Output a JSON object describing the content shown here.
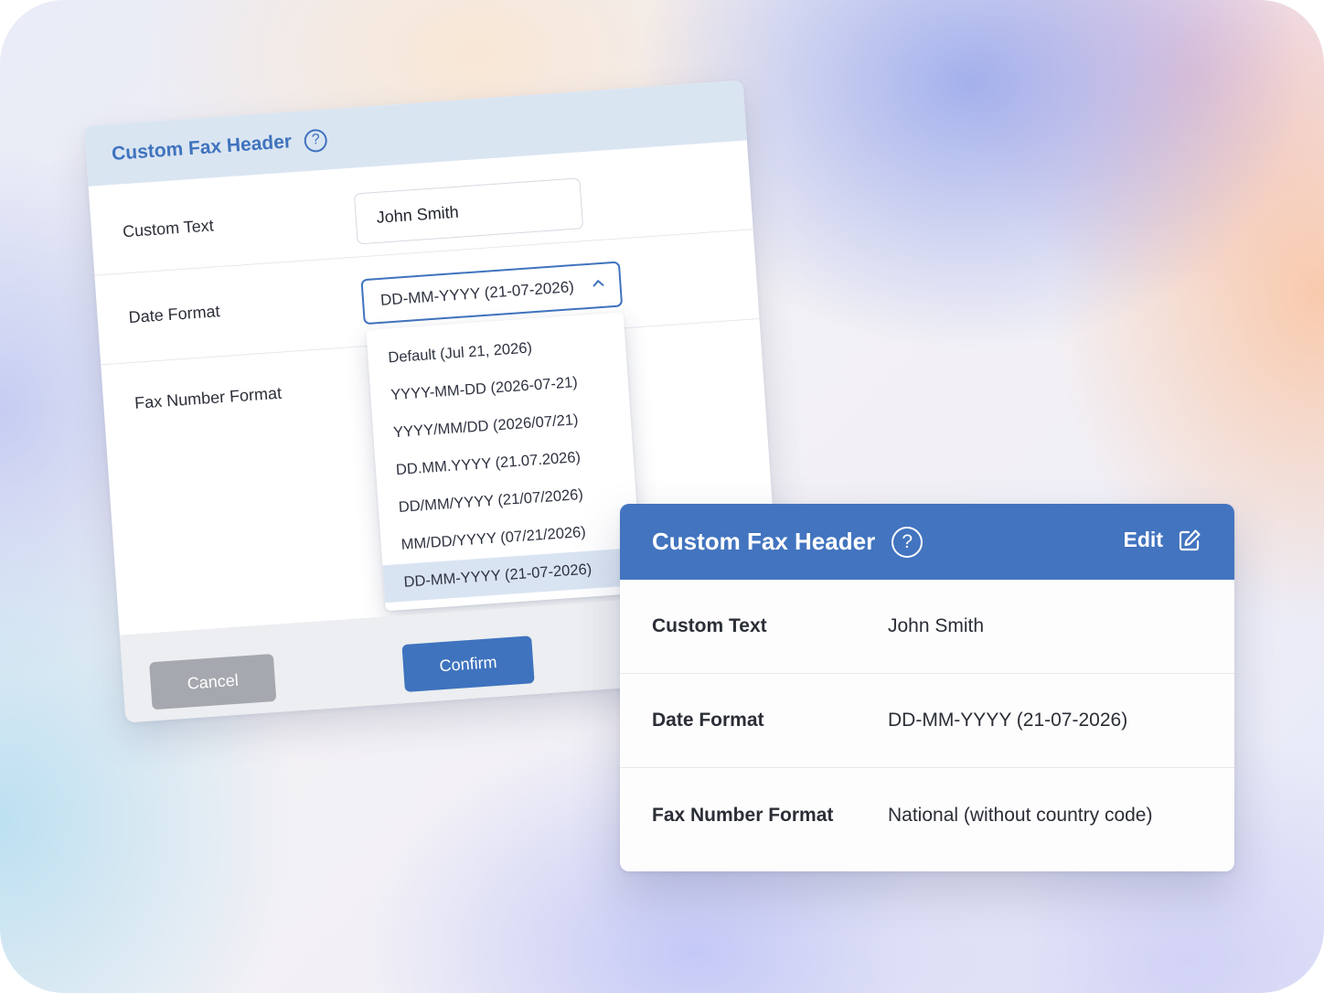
{
  "edit_dialog": {
    "title": "Custom Fax Header",
    "help_icon_glyph": "?",
    "fields": {
      "custom_text_label": "Custom Text",
      "custom_text_value": "John Smith",
      "date_format_label": "Date Format",
      "date_format_selected": "DD-MM-YYYY (21-07-2026)",
      "fax_number_format_label": "Fax Number Format"
    },
    "date_format_options": [
      "Default (Jul 21, 2026)",
      "YYYY-MM-DD (2026-07-21)",
      "YYYY/MM/DD (2026/07/21)",
      "DD.MM.YYYY (21.07.2026)",
      "DD/MM/YYYY (21/07/2026)",
      "MM/DD/YYYY (07/21/2026)",
      "DD-MM-YYYY (21-07-2026)"
    ],
    "cancel_label": "Cancel",
    "confirm_label": "Confirm"
  },
  "summary_card": {
    "title": "Custom Fax Header",
    "help_icon_glyph": "?",
    "edit_label": "Edit",
    "rows": [
      {
        "label": "Custom Text",
        "value": "John Smith"
      },
      {
        "label": "Date Format",
        "value": "DD-MM-YYYY (21-07-2026)"
      },
      {
        "label": "Fax Number Format",
        "value": "National (without country code)"
      }
    ]
  },
  "colors": {
    "accent": "#3f73be",
    "header_blue": "#4274bf",
    "header_light": "#dae5f2",
    "cancel_gray": "#a5a8ae"
  },
  "icons": [
    "question-circle-icon",
    "chevron-up-icon",
    "edit-pencil-icon"
  ]
}
